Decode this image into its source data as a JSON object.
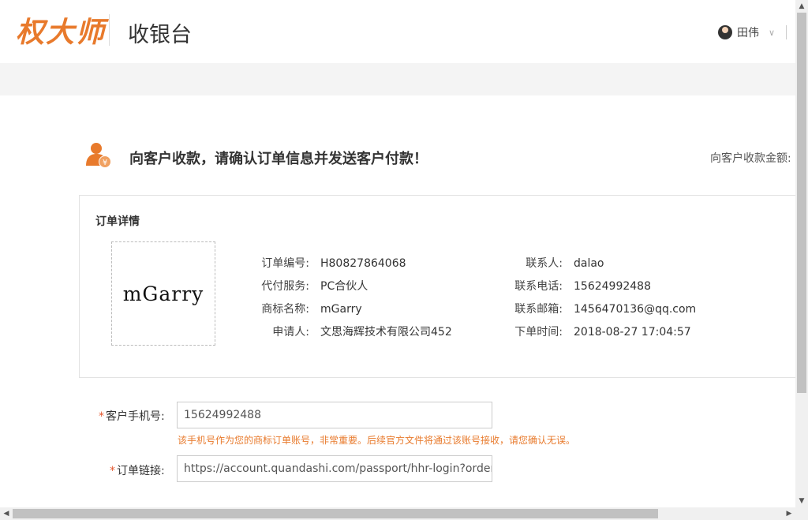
{
  "header": {
    "logo": "权大师",
    "app_title": "收银台",
    "user_name": "田伟"
  },
  "banner": {
    "message": "向客户收款，请确认订单信息并发送客户付款！",
    "amount_label": "向客户收款金额:"
  },
  "order": {
    "title": "订单详情",
    "brand_image_text": "mGarry",
    "left": [
      {
        "label": "订单编号:",
        "value": "H80827864068"
      },
      {
        "label": "代付服务:",
        "value": "PC合伙人"
      },
      {
        "label": "商标名称:",
        "value": "mGarry"
      },
      {
        "label": "申请人:",
        "value": "文思海辉技术有限公司452"
      }
    ],
    "right": [
      {
        "label": "联系人:",
        "value": "dalao"
      },
      {
        "label": "联系电话:",
        "value": "15624992488"
      },
      {
        "label": "联系邮箱:",
        "value": "1456470136@qq.com"
      },
      {
        "label": "下单时间:",
        "value": "2018-08-27 17:04:57"
      }
    ]
  },
  "form": {
    "phone_label": "客户手机号:",
    "phone_value": "15624992488",
    "phone_hint": "该手机号作为您的商标订单账号，非常重要。后续官方文件将通过该账号接收，请您确认无误。",
    "link_label": "订单链接:",
    "link_value": "https://account.quandashi.com/passport/hhr-login?orderNo",
    "required_mark": "*"
  },
  "colors": {
    "accent": "#e87a2c",
    "required": "#e4572e"
  },
  "icons": {
    "banner": "user-yen-icon",
    "avatar": "avatar",
    "dropdown": "chevron-down-icon"
  }
}
